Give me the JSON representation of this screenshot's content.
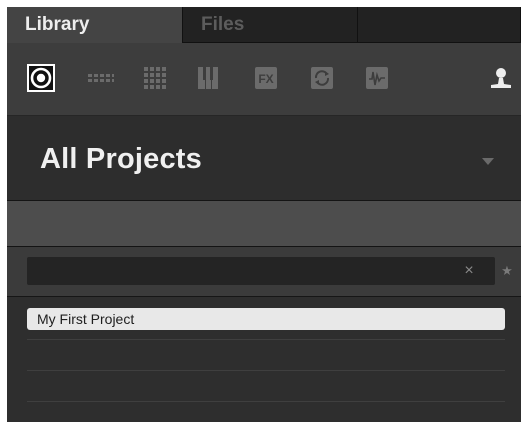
{
  "tabs": [
    {
      "label": "Library",
      "active": true
    },
    {
      "label": "Files",
      "active": false
    },
    {
      "label": "",
      "active": false
    }
  ],
  "icon_bar": {
    "icons": [
      "project-icon",
      "groups-icon",
      "sounds-icon",
      "instruments-icon",
      "effects-icon",
      "loops-icon",
      "one-shots-icon",
      "user-icon"
    ],
    "selected": "project-icon"
  },
  "header": {
    "title": "All Projects"
  },
  "search": {
    "value": "",
    "placeholder": "",
    "clear_label": "×",
    "favorite_label": "★"
  },
  "results": {
    "items": [
      "My First Project"
    ]
  },
  "colors": {
    "panel": "#2e2e2e",
    "selected_row": "#e8e8e8",
    "active_tab": "#444444"
  }
}
